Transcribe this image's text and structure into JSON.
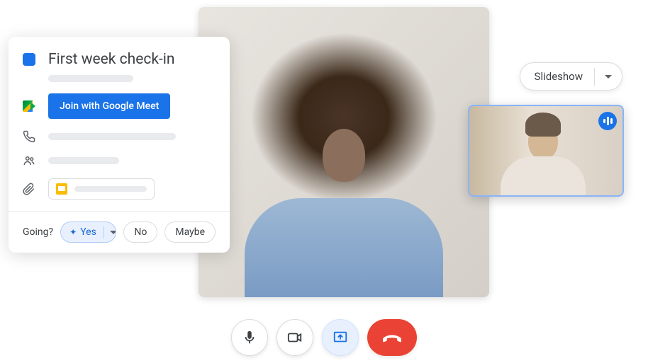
{
  "event": {
    "title": "First week check-in",
    "join_button": "Join with Google Meet",
    "color": "#1a73e8"
  },
  "rsvp": {
    "prompt": "Going?",
    "yes": "Yes",
    "no": "No",
    "maybe": "Maybe"
  },
  "slideshow": {
    "label": "Slideshow"
  },
  "controls": {
    "mic": "microphone",
    "camera": "camera",
    "present": "present-screen",
    "end": "end-call"
  }
}
